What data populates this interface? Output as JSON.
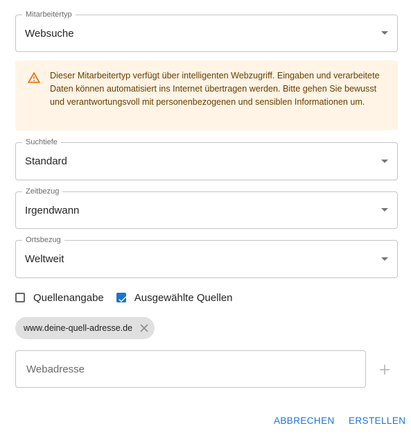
{
  "fields": {
    "mitarbeitertyp": {
      "label": "Mitarbeitertyp",
      "value": "Websuche"
    },
    "suchtiefe": {
      "label": "Suchtiefe",
      "value": "Standard"
    },
    "zeitbezug": {
      "label": "Zeitbezug",
      "value": "Irgendwann"
    },
    "ortsbezug": {
      "label": "Ortsbezug",
      "value": "Weltweit"
    }
  },
  "alert": {
    "icon": "warning-triangle-icon",
    "color": "#ed6c02",
    "background": "#fff4e5",
    "text": "Dieser Mitarbeitertyp verfügt über intelligenten Webzugriff. Eingaben und verarbeitete Daten können automatisiert ins Internet übertragen werden. Bitte gehen Sie bewusst und verantwortungsvoll mit personenbezogenen und sensiblen Informationen um."
  },
  "checkboxes": {
    "quellenangabe": {
      "label": "Quellenangabe",
      "checked": false
    },
    "ausgewaehlte_quellen": {
      "label": "Ausgewählte Quellen",
      "checked": true
    }
  },
  "chips": [
    {
      "label": "www.deine-quell-adresse.de"
    }
  ],
  "webadresse": {
    "placeholder": "Webadresse",
    "value": ""
  },
  "actions": {
    "cancel_label": "ABBRECHEN",
    "create_label": "ERSTELLEN"
  },
  "colors": {
    "primary": "#1976d2",
    "warning": "#ed6c02",
    "warning_text": "#663c00"
  }
}
